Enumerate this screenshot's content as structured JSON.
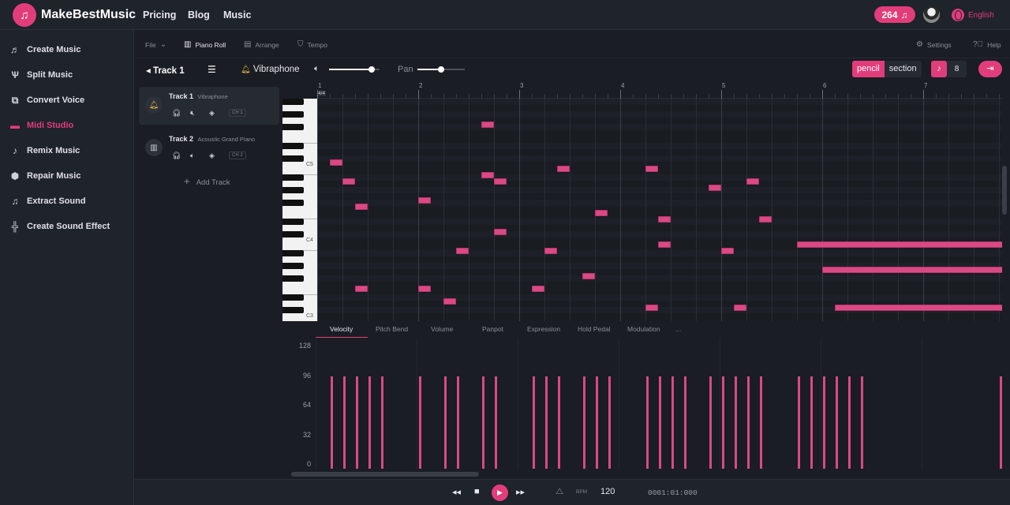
{
  "app": {
    "brand": "MakeBestMusic",
    "credits": "264",
    "language": "English"
  },
  "topnav": [
    "Pricing",
    "Blog",
    "Music"
  ],
  "sidebar": [
    {
      "label": "Create Music",
      "icon": "music-note-icon",
      "active": false
    },
    {
      "label": "Split Music",
      "icon": "split-icon",
      "active": false
    },
    {
      "label": "Convert Voice",
      "icon": "convert-icon",
      "active": false
    },
    {
      "label": "Midi Studio",
      "icon": "midi-icon",
      "active": true
    },
    {
      "label": "Remix Music",
      "icon": "remix-icon",
      "active": false
    },
    {
      "label": "Repair Music",
      "icon": "repair-icon",
      "active": false
    },
    {
      "label": "Extract Sound",
      "icon": "extract-icon",
      "active": false
    },
    {
      "label": "Create Sound Effect",
      "icon": "waveform-icon",
      "active": false
    }
  ],
  "toolbar": {
    "file": "File",
    "piano_roll": "Piano Roll",
    "arrange": "Arrange",
    "tempo": "Tempo",
    "settings": "Settings",
    "help": "Help"
  },
  "editor": {
    "track": "Track 1",
    "instrument": "Vibraphone",
    "volume": 0.85,
    "pan_label": "Pan",
    "pan": 0.5,
    "mode_on": "pencil",
    "mode_off": "section",
    "note_value": "8"
  },
  "tracks": [
    {
      "name": "Track 1",
      "instrument": "Vibraphone",
      "channel": "CH 1",
      "selected": true
    },
    {
      "name": "Track 2",
      "instrument": "Acoustic Grand Piano",
      "channel": "CH 2",
      "selected": false
    }
  ],
  "add_track": "Add Track",
  "ruler": {
    "bars": [
      "1",
      "2",
      "3",
      "4",
      "5",
      "6",
      "7"
    ],
    "time_signature": "4/4"
  },
  "keyboard": {
    "labels": [
      "C5",
      "C4",
      "C3"
    ]
  },
  "notes": [
    {
      "bar": 2.625,
      "len": 0.125,
      "row": 2
    },
    {
      "bar": 1.125,
      "len": 0.125,
      "row": 8
    },
    {
      "bar": 1.25,
      "len": 0.125,
      "row": 11
    },
    {
      "bar": 2.625,
      "len": 0.125,
      "row": 10
    },
    {
      "bar": 2.75,
      "len": 0.125,
      "row": 11
    },
    {
      "bar": 3.375,
      "len": 0.125,
      "row": 9
    },
    {
      "bar": 4.25,
      "len": 0.125,
      "row": 9
    },
    {
      "bar": 4.875,
      "len": 0.125,
      "row": 12
    },
    {
      "bar": 5.25,
      "len": 0.125,
      "row": 11
    },
    {
      "bar": 1.375,
      "len": 0.125,
      "row": 15
    },
    {
      "bar": 2.0,
      "len": 0.125,
      "row": 14
    },
    {
      "bar": 3.75,
      "len": 0.125,
      "row": 16
    },
    {
      "bar": 4.375,
      "len": 0.125,
      "row": 17
    },
    {
      "bar": 5.375,
      "len": 0.125,
      "row": 17
    },
    {
      "bar": 2.75,
      "len": 0.125,
      "row": 19
    },
    {
      "bar": 2.375,
      "len": 0.125,
      "row": 22
    },
    {
      "bar": 3.25,
      "len": 0.125,
      "row": 22
    },
    {
      "bar": 4.375,
      "len": 0.125,
      "row": 21
    },
    {
      "bar": 5.0,
      "len": 0.125,
      "row": 22
    },
    {
      "bar": 5.75,
      "len": 2.125,
      "row": 21
    },
    {
      "bar": 6.0,
      "len": 1.875,
      "row": 25
    },
    {
      "bar": 3.625,
      "len": 0.125,
      "row": 26
    },
    {
      "bar": 1.375,
      "len": 0.125,
      "row": 28
    },
    {
      "bar": 2.0,
      "len": 0.125,
      "row": 28
    },
    {
      "bar": 3.125,
      "len": 0.125,
      "row": 28
    },
    {
      "bar": 2.25,
      "len": 0.125,
      "row": 30
    },
    {
      "bar": 4.25,
      "len": 0.125,
      "row": 31
    },
    {
      "bar": 5.125,
      "len": 0.125,
      "row": 31
    },
    {
      "bar": 6.125,
      "len": 1.75,
      "row": 31
    }
  ],
  "controller": {
    "tabs": [
      "Velocity",
      "Pitch Bend",
      "Volume",
      "Panpot",
      "Expression",
      "Hold Pedal",
      "Modulation",
      "..."
    ],
    "active_tab": "Velocity",
    "y_labels": [
      "128",
      "96",
      "64",
      "32",
      "0"
    ],
    "velocity_value": 100,
    "velocity_bars": [
      1.125,
      1.25,
      1.375,
      1.5,
      1.625,
      2.0,
      2.25,
      2.375,
      2.625,
      2.75,
      3.125,
      3.25,
      3.375,
      3.625,
      3.75,
      3.875,
      4.25,
      4.375,
      4.5,
      4.625,
      4.875,
      5.0,
      5.125,
      5.25,
      5.375,
      5.75,
      5.875,
      6.0,
      6.125,
      6.25,
      6.375,
      7.75
    ]
  },
  "transport": {
    "bpm_label": "BPM",
    "bpm": "120",
    "time": "0001:01:000"
  }
}
